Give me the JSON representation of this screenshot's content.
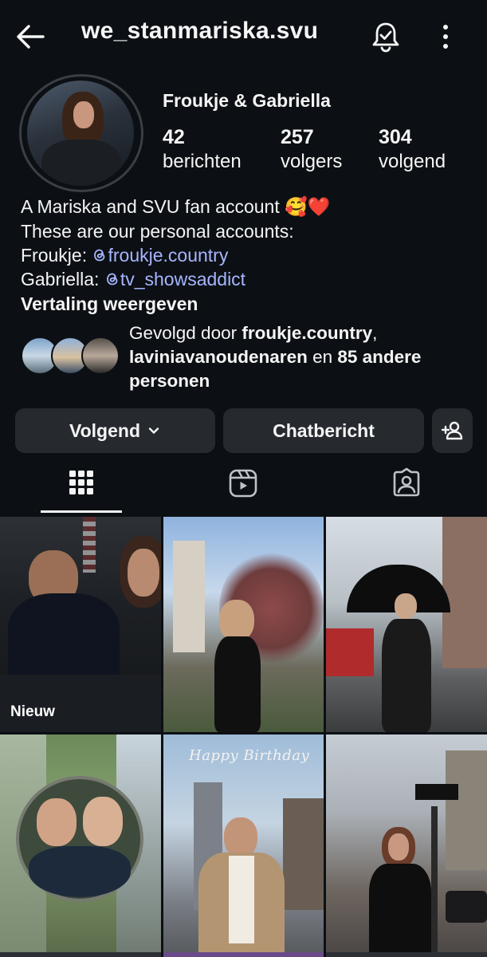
{
  "header": {
    "username": "we_stanmariska.svu",
    "icons": [
      "back-arrow-icon",
      "bell-icon",
      "more-vertical-icon"
    ]
  },
  "profile": {
    "display_name": "Froukje & Gabriella",
    "stats": [
      {
        "count": "42",
        "label": "berichten"
      },
      {
        "count": "257",
        "label": "volgers"
      },
      {
        "count": "304",
        "label": "volgend"
      }
    ],
    "bio": {
      "line1": "A Mariska and SVU fan account 🥰❤️",
      "line2": "These are our personal accounts:",
      "line3_prefix": "Froukje: ",
      "line3_link": "froukje.country",
      "line4_prefix": "Gabriella: ",
      "line4_link": "tv_showsaddict",
      "link_color": "#a7b5ff"
    },
    "translate_label": "Vertaling weergeven",
    "followed_by": {
      "prefix": "Gevolgd door ",
      "user1": "froukje.country",
      "sep": ",",
      "user2": "laviniavanoudenaren",
      "middle": " en ",
      "others": "85 andere personen"
    }
  },
  "actions": {
    "following_label": "Volgend",
    "message_label": "Chatbericht",
    "add_user_icon": "add-user-icon"
  },
  "tabs": [
    {
      "name": "grid",
      "icon": "grid-icon",
      "active": true
    },
    {
      "name": "reels",
      "icon": "reels-icon",
      "active": false
    },
    {
      "name": "tagged",
      "icon": "tagged-icon",
      "active": false
    }
  ],
  "posts": [
    {
      "badge": "Nieuw"
    },
    {},
    {},
    {},
    {
      "caption": "Happy Birthday"
    },
    {}
  ],
  "colors": {
    "background": "#0c1014",
    "button": "#262a2f",
    "link": "#a7b5ff"
  }
}
